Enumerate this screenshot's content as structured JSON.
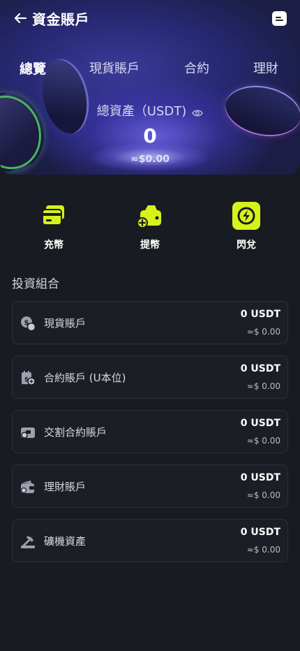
{
  "header": {
    "title": "資金賬戶",
    "back_icon": "arrow-left-icon",
    "doc_icon": "document-icon"
  },
  "tabs": [
    {
      "label": "總覽",
      "active": true
    },
    {
      "label": "現貨賬戶",
      "active": false
    },
    {
      "label": "合約",
      "active": false
    },
    {
      "label": "理財",
      "active": false
    }
  ],
  "overview": {
    "asset_label": "總資產（USDT)",
    "total": "0",
    "fiat": "≈$0.00"
  },
  "actions": [
    {
      "label": "充幣",
      "icon": "card-icon"
    },
    {
      "label": "提幣",
      "icon": "withdraw-wallet-icon"
    },
    {
      "label": "閃兌",
      "icon": "lightning-icon"
    }
  ],
  "portfolio": {
    "title": "投資組合",
    "accounts": [
      {
        "name": "現貨賬戶",
        "amount": "0 USDT",
        "fiat": "≈$ 0.00",
        "icon": "coins-icon"
      },
      {
        "name": "合約賬戶 (U本位)",
        "amount": "0 USDT",
        "fiat": "≈$ 0.00",
        "icon": "contract-icon"
      },
      {
        "name": "交割合約賬戶",
        "amount": "0 USDT",
        "fiat": "≈$ 0.00",
        "icon": "delivery-icon"
      },
      {
        "name": "理財賬戶",
        "amount": "0 USDT",
        "fiat": "≈$ 0.00",
        "icon": "wallet-icon"
      },
      {
        "name": "礦機資產",
        "amount": "0 USDT",
        "fiat": "≈$ 0.00",
        "icon": "mining-icon"
      }
    ]
  },
  "colors": {
    "accent": "#d7f21b",
    "background": "#191b22",
    "card_border": "#2c2f3a"
  }
}
